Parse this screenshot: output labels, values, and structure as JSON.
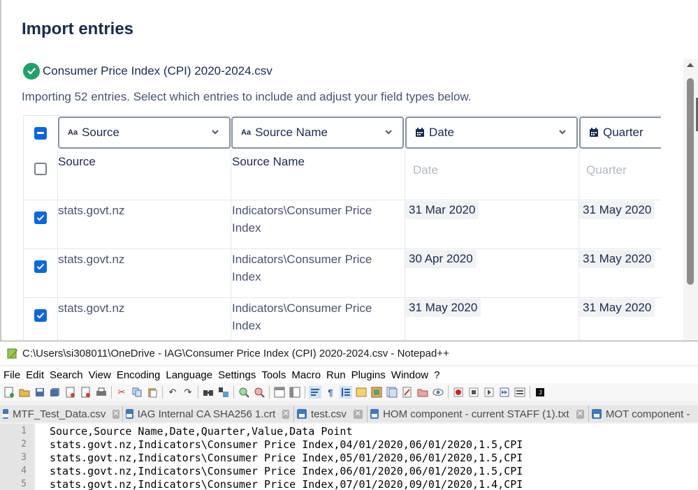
{
  "dialog": {
    "title": "Import entries",
    "file_name": "Consumer Price Index (CPI) 2020-2024.csv",
    "subtitle": "Importing 52 entries. Select which entries to include and adjust your field types below.",
    "columns": [
      {
        "label": "Source",
        "icon": "text-type-icon"
      },
      {
        "label": "Source Name",
        "icon": "text-type-icon"
      },
      {
        "label": "Date",
        "icon": "calendar-icon"
      },
      {
        "label": "Quarter",
        "icon": "calendar-icon"
      }
    ],
    "header_row": {
      "source": "Source",
      "source_name": "Source Name",
      "date": "Date",
      "quarter": "Quarter",
      "checked": false
    },
    "rows": [
      {
        "checked": true,
        "source": "stats.govt.nz",
        "source_name_1": "Indicators\\Consumer Price",
        "source_name_2": "Index",
        "date": "31 Mar 2020",
        "quarter": "31 May 2020"
      },
      {
        "checked": true,
        "source": "stats.govt.nz",
        "source_name_1": "Indicators\\Consumer Price",
        "source_name_2": "Index",
        "date": "30 Apr 2020",
        "quarter": "31 May 2020"
      },
      {
        "checked": true,
        "source": "stats.govt.nz",
        "source_name_1": "Indicators\\Consumer Price",
        "source_name_2": "Index",
        "date": "31 May 2020",
        "quarter": "31 May 2020"
      }
    ]
  },
  "notepad": {
    "title": "C:\\Users\\si308011\\OneDrive - IAG\\Consumer Price Index (CPI) 2020-2024.csv - Notepad++",
    "menu": [
      "File",
      "Edit",
      "Search",
      "View",
      "Encoding",
      "Language",
      "Settings",
      "Tools",
      "Macro",
      "Run",
      "Plugins",
      "Window",
      "?"
    ],
    "tabs": [
      {
        "name": "MTF_Test_Data.csv",
        "active": false
      },
      {
        "name": "IAG Internal CA SHA256 1.crt",
        "active": false
      },
      {
        "name": "test.csv",
        "active": false
      },
      {
        "name": "HOM component - current STAFF (1).txt",
        "active": false
      },
      {
        "name": "MOT component -",
        "active": false
      }
    ],
    "lines": [
      {
        "n": "1",
        "text": "Source,Source Name,Date,Quarter,Value,Data Point"
      },
      {
        "n": "2",
        "text": "stats.govt.nz,Indicators\\Consumer Price Index,04/01/2020,06/01/2020,1.5,CPI"
      },
      {
        "n": "3",
        "text": "stats.govt.nz,Indicators\\Consumer Price Index,05/01/2020,06/01/2020,1.5,CPI"
      },
      {
        "n": "4",
        "text": "stats.govt.nz,Indicators\\Consumer Price Index,06/01/2020,06/01/2020,1.5,CPI"
      },
      {
        "n": "5",
        "text": "stats.govt.nz,Indicators\\Consumer Price Index,07/01/2020,09/01/2020,1.4,CPI"
      }
    ]
  },
  "colors": {
    "accent": "#0c66e4",
    "success": "#22a06b",
    "text": "#172b4d"
  }
}
